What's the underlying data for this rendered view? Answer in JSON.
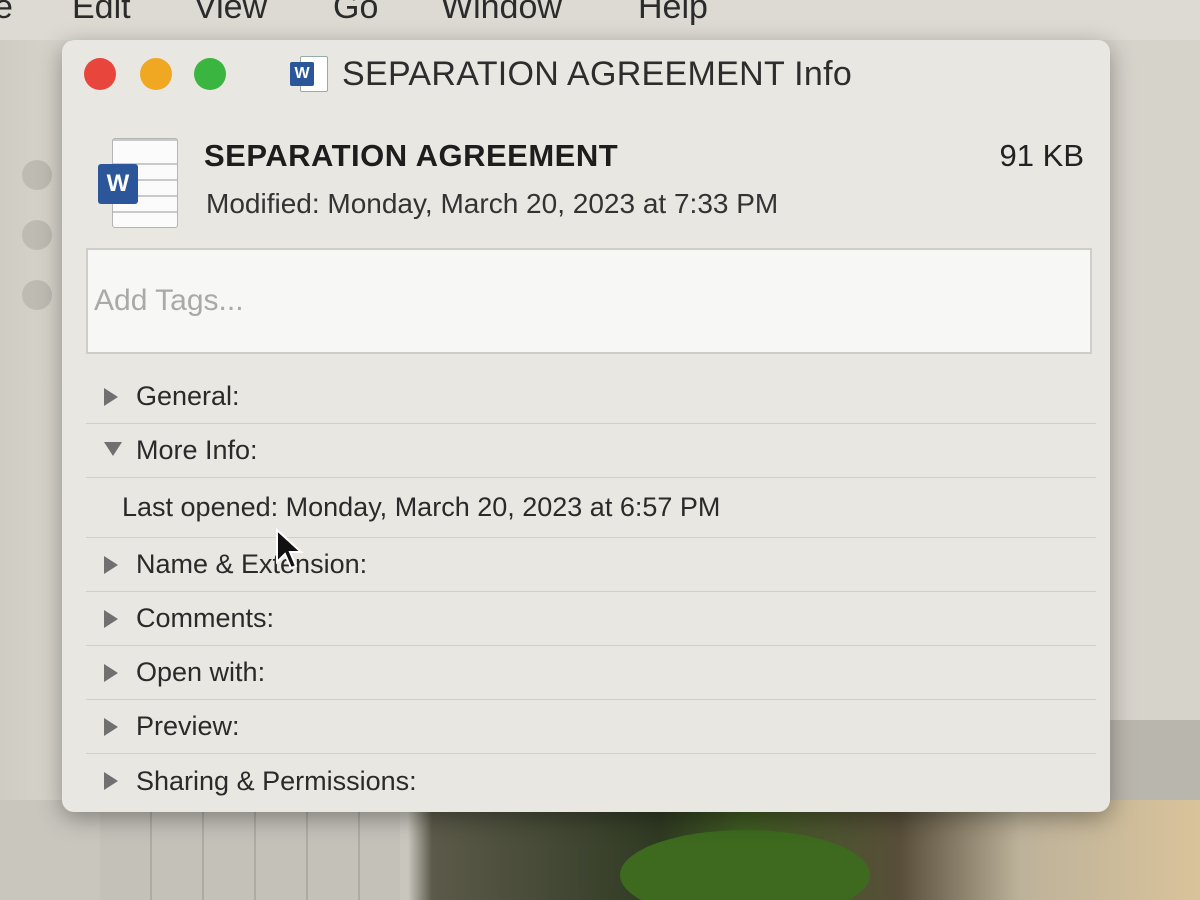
{
  "menubar": {
    "items": [
      "e",
      "Edit",
      "View",
      "Go",
      "Window",
      "Help"
    ]
  },
  "window": {
    "title": "SEPARATION AGREEMENT Info",
    "icon": "word-document-icon"
  },
  "file": {
    "name": "SEPARATION AGREEMENT",
    "size": "91 KB",
    "modified": "Modified: Monday, March 20, 2023 at 7:33 PM"
  },
  "tags": {
    "placeholder": "Add Tags..."
  },
  "sections": {
    "general": "General:",
    "more_info": "More Info:",
    "last_opened": "Last opened: Monday, March 20, 2023 at 6:57 PM",
    "name_extension": "Name & Extension:",
    "comments": "Comments:",
    "open_with": "Open with:",
    "preview": "Preview:",
    "sharing_permissions": "Sharing & Permissions:"
  },
  "icons": {
    "word_badge": "W"
  },
  "colors": {
    "close": "#e8463c",
    "minimize": "#f0a722",
    "zoom": "#3ab53f",
    "word_blue": "#2b579a"
  }
}
